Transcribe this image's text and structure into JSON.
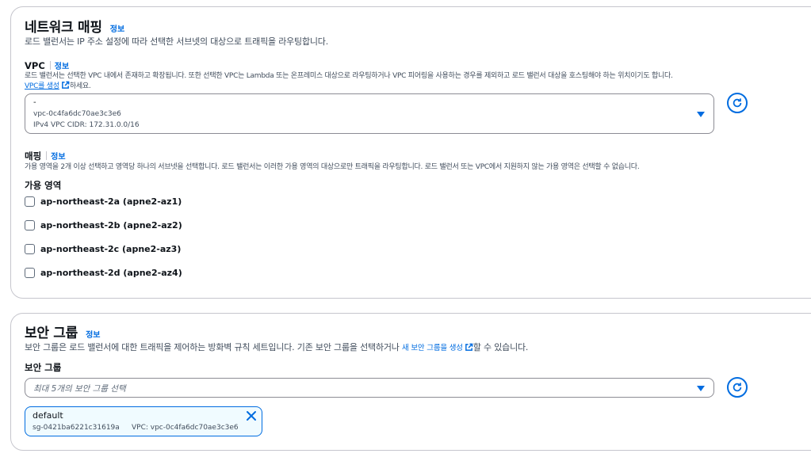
{
  "network": {
    "title": "네트워크 매핑",
    "info": "정보",
    "description": "로드 밸런서는 IP 주소 설정에 따라 선택한 서브넷의 대상으로 트래픽을 라우팅합니다.",
    "vpc": {
      "label": "VPC",
      "info": "정보",
      "description": "로드 밸런서는 선택한 VPC 내에서 존재하고 확장됩니다. 또한 선택한 VPC는 Lambda 또는 온프레미스 대상으로 라우팅하거나 VPC 피어링을 사용하는 경우를 제외하고 로드 밸런서 대상을 호스팅해야 하는 위치이기도 합니다.",
      "create_link": "VPC를 생성",
      "create_suffix": "하세요.",
      "selected_name": "-",
      "selected_id": "vpc-0c4fa6dc70ae3c3e6",
      "selected_cidr": "IPv4 VPC CIDR: 172.31.0.0/16"
    },
    "mapping": {
      "label": "매핑",
      "info": "정보",
      "description": "가용 영역을 2개 이상 선택하고 영역당 하나의 서브넷을 선택합니다. 로드 밸런서는 이러한 가용 영역의 대상으로만 트래픽을 라우팅합니다. 로드 밸런서 또는 VPC에서 지원하지 않는 가용 영역은 선택할 수 없습니다.",
      "az_heading": "가용 영역",
      "zones": [
        {
          "label": "ap-northeast-2a (apne2-az1)",
          "checked": false
        },
        {
          "label": "ap-northeast-2b (apne2-az2)",
          "checked": false
        },
        {
          "label": "ap-northeast-2c (apne2-az3)",
          "checked": false
        },
        {
          "label": "ap-northeast-2d (apne2-az4)",
          "checked": false
        }
      ]
    }
  },
  "security": {
    "title": "보안 그룹",
    "info": "정보",
    "description_prefix": "보안 그룹은 로드 밸런서에 대한 트래픽을 제어하는 방화벽 규칙 세트입니다. 기존 보안 그룹을 선택하거나",
    "create_link": "새 보안 그룹을 생성",
    "description_suffix": "할 수 있습니다.",
    "field_label": "보안 그룹",
    "placeholder": "최대 5개의 보안 그룹 선택",
    "token": {
      "name": "default",
      "id": "sg-0421ba6221c31619a",
      "vpc": "VPC: vpc-0c4fa6dc70ae3c3e6"
    }
  },
  "colors": {
    "link": "#006ce0",
    "border": "#c6c6cd",
    "token_bg": "#f0fbff"
  }
}
